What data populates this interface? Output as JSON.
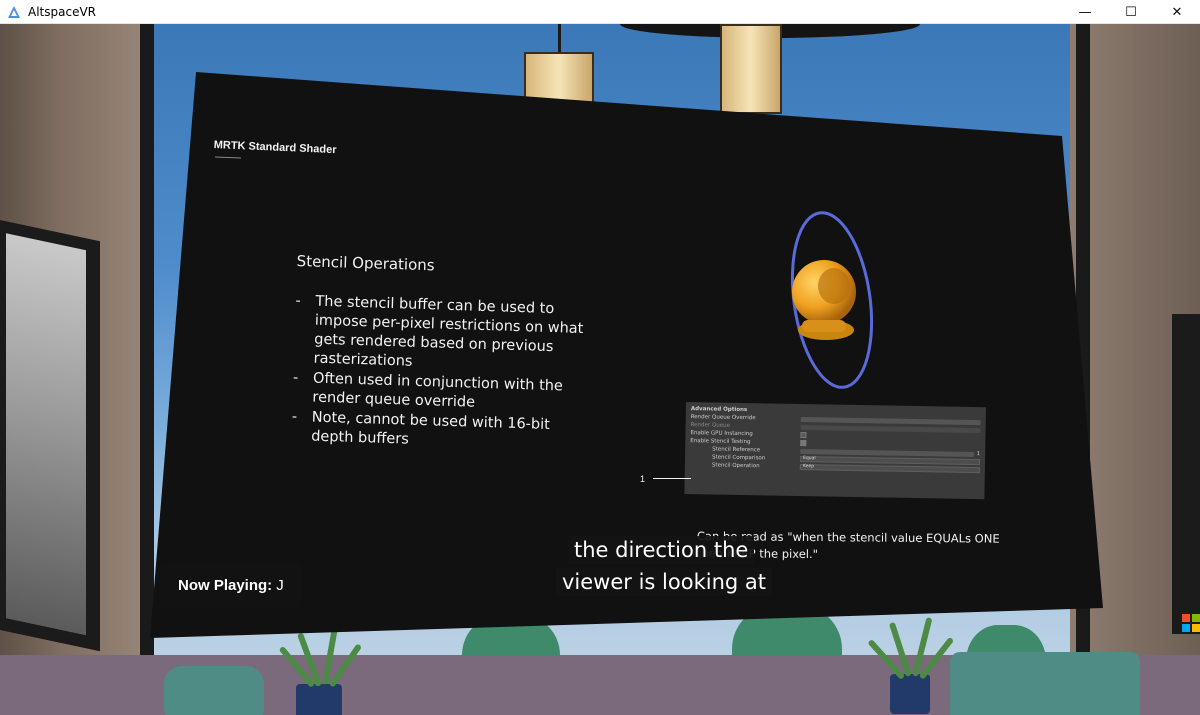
{
  "window": {
    "title": "AltspaceVR",
    "minimize": "—",
    "maximize": "☐",
    "close": "✕"
  },
  "slide": {
    "title": "MRTK Standard Shader",
    "heading": "Stencil Operations",
    "bullets": [
      "The stencil buffer can be used to impose per-pixel restrictions on what gets rendered based on previous rasterizations",
      "Often used in conjunction with the render queue override",
      "Note, cannot be used with 16-bit depth buffers"
    ],
    "inspector": {
      "section": "Advanced Options",
      "rows": [
        {
          "label": "Render Queue Override",
          "value": "",
          "indent": false
        },
        {
          "label": "Render Queue",
          "value": "",
          "indent": false
        },
        {
          "label": "Enable GPU Instancing",
          "value": "",
          "indent": false
        },
        {
          "label": "Enable Stencil Testing",
          "value": "",
          "indent": false
        },
        {
          "label": "Stencil Reference",
          "value": "1",
          "indent": true
        },
        {
          "label": "Stencil Comparison",
          "value": "Equal",
          "indent": true
        },
        {
          "label": "Stencil Operation",
          "value": "Keep",
          "indent": true
        }
      ]
    },
    "pointer_label": "1",
    "note": "Can be read as \"when the stencil value EQUALs ONE then KEEP the pixel.\""
  },
  "subtitles": {
    "line1": "the direction the",
    "line2": "viewer is looking at"
  },
  "now_playing": {
    "label": "Now Playing:",
    "value": "J"
  },
  "colors": {
    "screen": "#111111",
    "orb": "#f0a020",
    "ring": "#5a6bd8"
  }
}
